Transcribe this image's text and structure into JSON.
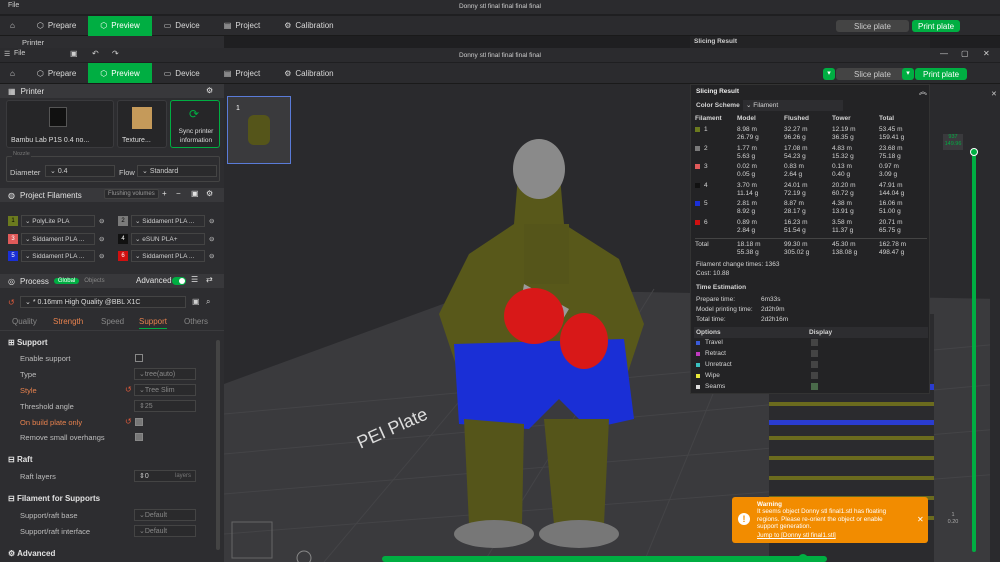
{
  "window": {
    "title": "Donny stl final final final final"
  },
  "menu": {
    "file": "File"
  },
  "toolbar": {
    "tabs": [
      {
        "label": "Prepare"
      },
      {
        "label": "Preview"
      },
      {
        "label": "Device"
      },
      {
        "label": "Project"
      },
      {
        "label": "Calibration"
      }
    ],
    "slice_label": "Slice plate",
    "print_label": "Print plate"
  },
  "printer": {
    "section": "Printer",
    "name": "Bambu Lab P1S 0.4 no...",
    "texture": "Texture...",
    "sync": "Sync printer information",
    "nozzle_label": "Nozzle",
    "diameter_label": "Diameter",
    "diameter_value": "0.4",
    "flow_label": "Flow",
    "flow_value": "Standard"
  },
  "filaments": {
    "section": "Project Filaments",
    "flushing": "Flushing volumes",
    "items": [
      {
        "num": "1",
        "name": "PolyLite PLA",
        "color": "#6b7a1e"
      },
      {
        "num": "2",
        "name": "Siddament PLA ...",
        "color": "#7a7a7a"
      },
      {
        "num": "3",
        "name": "Siddament PLA ...",
        "color": "#e05a5a"
      },
      {
        "num": "4",
        "name": "eSUN PLA+",
        "color": "#111111"
      },
      {
        "num": "5",
        "name": "Siddament PLA ...",
        "color": "#1a2fd6"
      },
      {
        "num": "6",
        "name": "Siddament PLA ...",
        "color": "#d01010"
      }
    ]
  },
  "process": {
    "section": "Process",
    "global": "Global",
    "objects": "Objects",
    "advanced": "Advanced",
    "preset": "* 0.16mm High Quality @BBL X1C",
    "tabs": [
      "Quality",
      "Strength",
      "Speed",
      "Support",
      "Others"
    ]
  },
  "support": {
    "header": "Support",
    "enable": "Enable support",
    "type_label": "Type",
    "type_value": "tree(auto)",
    "style_label": "Style",
    "style_value": "Tree Slim",
    "threshold_label": "Threshold angle",
    "threshold_value": "25",
    "build_plate": "On build plate only",
    "remove_small": "Remove small overhangs",
    "raft_header": "Raft",
    "raft_layers": "Raft layers",
    "raft_value": "0",
    "raft_unit": "layers",
    "fil_header": "Filament for Supports",
    "raft_base": "Support/raft base",
    "raft_interface": "Support/raft interface",
    "default": "Default",
    "advanced": "Advanced"
  },
  "plate": {
    "text": "PEI Plate",
    "thumb_num": "1"
  },
  "slicing": {
    "title": "Slicing Result",
    "color_scheme_label": "Color Scheme",
    "color_scheme_value": "Filament",
    "headers": [
      "Filament",
      "Model",
      "Flushed",
      "Tower",
      "Total"
    ],
    "rows": [
      {
        "num": "1",
        "color": "#6b7a1e",
        "model": [
          "8.98 m",
          "26.79 g"
        ],
        "flushed": [
          "32.27 m",
          "96.26 g"
        ],
        "tower": [
          "12.19 m",
          "36.35 g"
        ],
        "total": [
          "53.45 m",
          "159.41 g"
        ]
      },
      {
        "num": "2",
        "color": "#7a7a7a",
        "model": [
          "1.77 m",
          "5.63 g"
        ],
        "flushed": [
          "17.08 m",
          "54.23 g"
        ],
        "tower": [
          "4.83 m",
          "15.32 g"
        ],
        "total": [
          "23.68 m",
          "75.18 g"
        ]
      },
      {
        "num": "3",
        "color": "#e05a5a",
        "model": [
          "0.02 m",
          "0.05 g"
        ],
        "flushed": [
          "0.83 m",
          "2.64 g"
        ],
        "tower": [
          "0.13 m",
          "0.40 g"
        ],
        "total": [
          "0.97 m",
          "3.09 g"
        ]
      },
      {
        "num": "4",
        "color": "#111111",
        "model": [
          "3.70 m",
          "11.14 g"
        ],
        "flushed": [
          "24.01 m",
          "72.19 g"
        ],
        "tower": [
          "20.20 m",
          "60.72 g"
        ],
        "total": [
          "47.91 m",
          "144.04 g"
        ]
      },
      {
        "num": "5",
        "color": "#1a2fd6",
        "model": [
          "2.81 m",
          "8.92 g"
        ],
        "flushed": [
          "8.87 m",
          "28.17 g"
        ],
        "tower": [
          "4.38 m",
          "13.91 g"
        ],
        "total": [
          "16.06 m",
          "51.00 g"
        ]
      },
      {
        "num": "6",
        "color": "#d01010",
        "model": [
          "0.89 m",
          "2.84 g"
        ],
        "flushed": [
          "16.23 m",
          "51.54 g"
        ],
        "tower": [
          "3.58 m",
          "11.37 g"
        ],
        "total": [
          "20.71 m",
          "65.75 g"
        ]
      }
    ],
    "total": {
      "label": "Total",
      "model": [
        "18.18 m",
        "55.38 g"
      ],
      "flushed": [
        "99.30 m",
        "305.02 g"
      ],
      "tower": [
        "45.30 m",
        "138.08 g"
      ],
      "total": [
        "162.78 m",
        "498.47 g"
      ]
    },
    "change_label": "Filament change times:",
    "change_value": "1363",
    "cost_label": "Cost:",
    "cost_value": "10.88",
    "time_title": "Time Estimation",
    "prepare_label": "Prepare time:",
    "prepare_value": "6m33s",
    "model_label": "Model printing time:",
    "model_value": "2d2h9m",
    "total_label": "Total time:",
    "total_value": "2d2h16m",
    "options_label": "Options",
    "display_label": "Display",
    "options": [
      {
        "label": "Travel",
        "color": "#3a5bd8",
        "checked": false
      },
      {
        "label": "Retract",
        "color": "#c03ac0",
        "checked": false
      },
      {
        "label": "Unretract",
        "color": "#3ac0c0",
        "checked": false
      },
      {
        "label": "Wipe",
        "color": "#e8e83a",
        "checked": false
      },
      {
        "label": "Seams",
        "color": "#dddddd",
        "checked": true
      }
    ]
  },
  "layer_slider": {
    "top_value": "937",
    "top_height": "149.96",
    "bottom_value": "1",
    "bottom_height": "0.20"
  },
  "warning": {
    "title": "Warning",
    "body": "It seems object Donny stl final1.stl has floating regions. Please re-orient the object or enable support generation.",
    "link": "Jump to [Donny stl final1.stl]"
  },
  "colors": {
    "accent": "#00ae42",
    "warning": "#f28c00",
    "panel": "#2d2d30"
  }
}
